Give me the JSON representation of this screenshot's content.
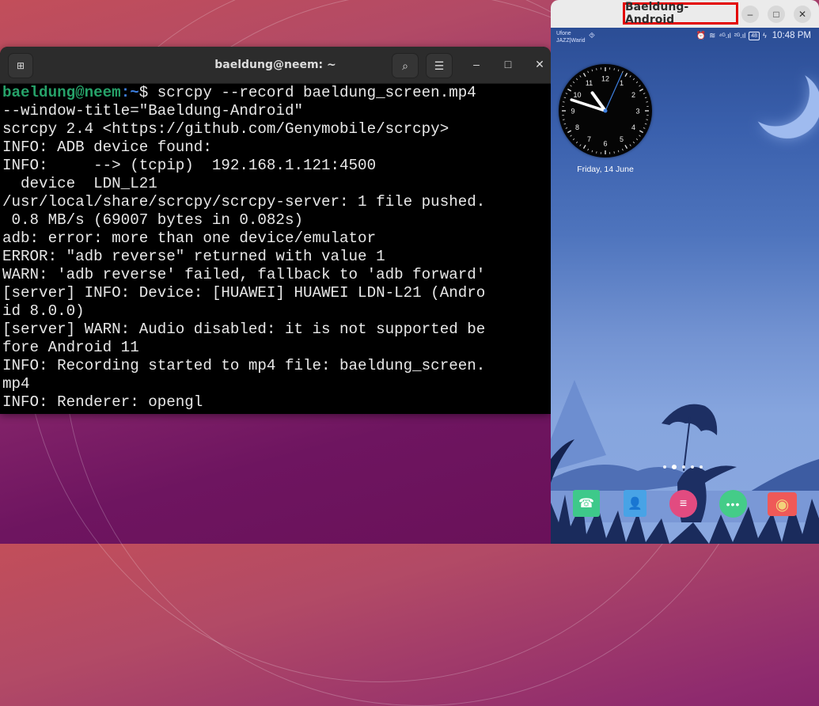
{
  "terminal": {
    "title": "baeldung@neem: ~",
    "new_tab_icon": "new-tab-icon",
    "search_icon": "search-icon",
    "menu_icon": "hamburger-menu-icon",
    "minimize_label": "–",
    "maximize_label": "□",
    "close_label": "✕",
    "prompt_user": "baeldung@neem",
    "prompt_path": ":~",
    "prompt_symbol": "$ ",
    "command": "scrcpy --record baeldung_screen.mp4",
    "lines": [
      "--window-title=\"Baeldung-Android\"",
      "scrcpy 2.4 <https://github.com/Genymobile/scrcpy>",
      "INFO: ADB device found:",
      "INFO:     --> (tcpip)  192.168.1.121:4500",
      "  device  LDN_L21",
      "/usr/local/share/scrcpy/scrcpy-server: 1 file pushed.",
      " 0.8 MB/s (69007 bytes in 0.082s)",
      "adb: error: more than one device/emulator",
      "ERROR: \"adb reverse\" returned with value 1",
      "WARN: 'adb reverse' failed, fallback to 'adb forward'",
      "[server] INFO: Device: [HUAWEI] HUAWEI LDN-L21 (Andro",
      "id 8.0.0)",
      "[server] WARN: Audio disabled: it is not supported be",
      "fore Android 11",
      "INFO: Recording started to mp4 file: baeldung_screen.",
      "mp4",
      "INFO: Renderer: opengl"
    ]
  },
  "android_window": {
    "title": "Baeldung-Android",
    "title_highlight_color": "#e30000",
    "minimize_label": "–",
    "maximize_label": "□",
    "close_label": "✕",
    "status_bar": {
      "carrier_1": "Ufone",
      "carrier_2": "JAZZ|Warid",
      "usb_icon": "⯑",
      "alarm_icon": "⏰",
      "wifi_icon": "wifi-icon",
      "signal_1": "⁴ᴳ.ıl",
      "signal_2": "²ᴳ.ıl",
      "battery": "48",
      "charging": "ϟ",
      "time": "10:48 PM"
    },
    "clock_widget": {
      "hour": 10,
      "minute": 48,
      "second": 4,
      "numerals": [
        "12",
        "1",
        "2",
        "3",
        "4",
        "5",
        "6",
        "7",
        "8",
        "9",
        "10",
        "11"
      ],
      "date": "Friday, 14 June"
    },
    "home_pages": {
      "count": 5,
      "active": 1
    },
    "dock": [
      {
        "name": "phone",
        "label": "☎"
      },
      {
        "name": "contacts",
        "label": "👤"
      },
      {
        "name": "app-drawer",
        "label": "≡"
      },
      {
        "name": "messages",
        "label": "•••"
      },
      {
        "name": "camera",
        "label": "◉"
      }
    ]
  }
}
